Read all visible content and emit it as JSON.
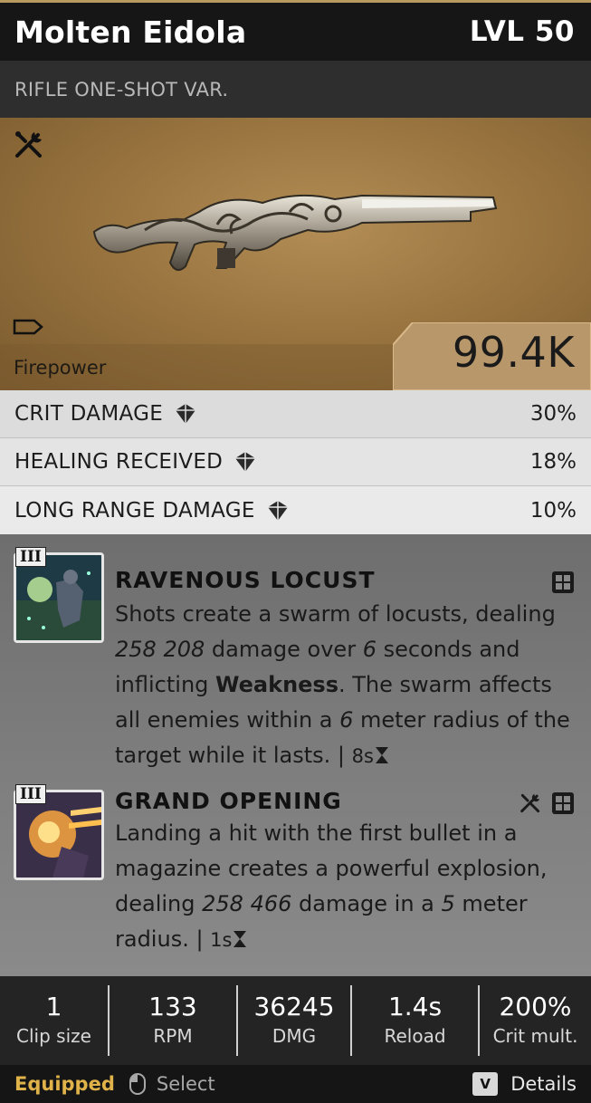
{
  "header": {
    "title": "Molten Eidola",
    "level": "LVL 50"
  },
  "subtitle": "RIFLE ONE-SHOT VAR.",
  "hero": {
    "firepower_label": "Firepower",
    "firepower_value": "99.4K"
  },
  "stats": [
    {
      "label": "CRIT DAMAGE",
      "value": "30%"
    },
    {
      "label": "HEALING RECEIVED",
      "value": "18%"
    },
    {
      "label": "LONG RANGE DAMAGE",
      "value": "10%"
    }
  ],
  "perks": [
    {
      "tier": "III",
      "name": "RAVENOUS LOCUST",
      "icons": [
        "grid-icon"
      ],
      "desc": {
        "p1": "Shots create a swarm of locusts, dealing ",
        "dmg": "258 208",
        "p2": " damage over ",
        "secs": "6",
        "p3": " seconds and inflicting ",
        "effect": "Weakness",
        "p4": ". The swarm affects all enemies within a ",
        "radius": "6",
        "p5": " meter radius of the target while it lasts. | ",
        "cooldown": "8s"
      }
    },
    {
      "tier": "III",
      "name": "GRAND OPENING",
      "icons": [
        "wrench-screwdriver-icon",
        "grid-icon"
      ],
      "desc": {
        "p1": "Landing a hit with the first bullet in a magazine creates a powerful explosion, dealing ",
        "dmg": "258 466",
        "p2": " damage in a ",
        "radius": "5",
        "p3": " meter radius. | ",
        "cooldown": "1s"
      }
    }
  ],
  "bottom_stats": [
    {
      "value": "1",
      "label": "Clip size"
    },
    {
      "value": "133",
      "label": "RPM"
    },
    {
      "value": "36245",
      "label": "DMG"
    },
    {
      "value": "1.4s",
      "label": "Reload"
    },
    {
      "value": "200%",
      "label": "Crit mult."
    }
  ],
  "footer": {
    "equipped": "Equipped",
    "select": "Select",
    "details_key": "V",
    "details": "Details"
  },
  "colors": {
    "accent_gold": "#e0b24a",
    "hero_bg": "#a07a45",
    "stats_bg": "#dcdcdc"
  }
}
